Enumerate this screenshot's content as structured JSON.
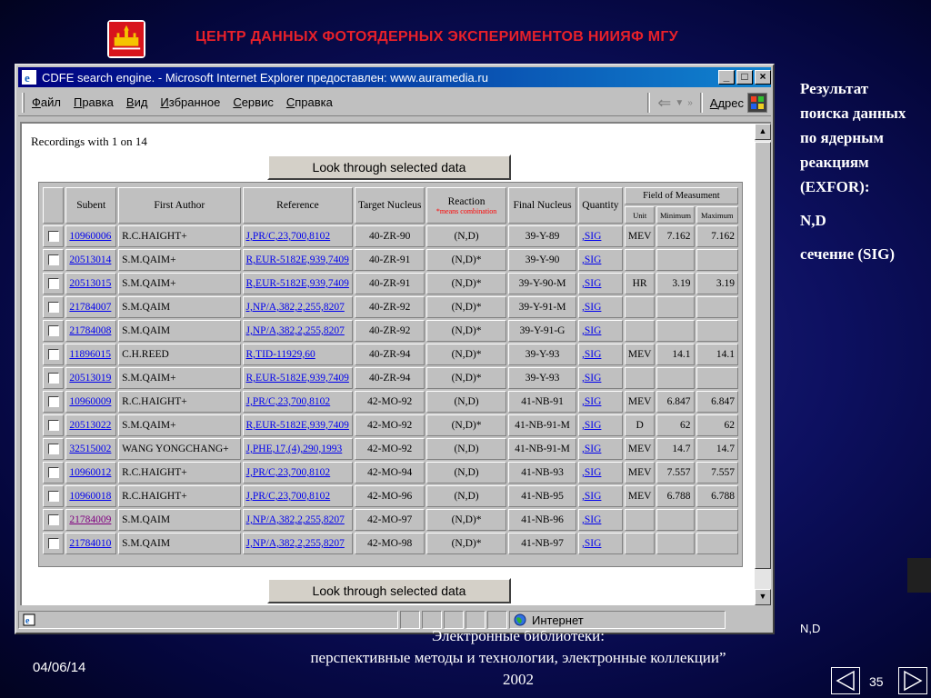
{
  "slide": {
    "title": "ЦЕНТР ДАННЫХ ФОТОЯДЕРНЫХ ЭКСПЕРИМЕНТОВ НИИЯФ МГУ",
    "right_panel": {
      "line1": "Результат поиска данных по ядерным реакциям (EXFOR):",
      "line2": "N,D",
      "line3": "сечение (SIG)"
    },
    "small_label": "N,D",
    "footer": {
      "date": "04/06/14",
      "line1": "Электронные библиотеки:",
      "line2": "перспективные методы и технологии, электронные коллекции”",
      "line3": "2002",
      "page_number": "35"
    }
  },
  "browser": {
    "window_title": "CDFE search engine. - Microsoft Internet Explorer предоставлен: www.auramedia.ru",
    "menu": [
      "Файл",
      "Правка",
      "Вид",
      "Избранное",
      "Сервис",
      "Справка"
    ],
    "address_label": "Адрес",
    "status_zone": "Интернет"
  },
  "page": {
    "recordings": "Recordings with 1 on 14",
    "look_button": "Look through selected data",
    "headers": {
      "subent": "Subent",
      "first_author": "First Author",
      "reference": "Reference",
      "target": "Target Nucleus",
      "reaction": "Reaction",
      "reaction_note": "*means combination",
      "final": "Final Nucleus",
      "quantity": "Quantity",
      "field": "Field of Measument",
      "unit": "Unit",
      "minimum": "Minimum",
      "maximum": "Maximum"
    },
    "rows": [
      {
        "subent": "10960006",
        "author": "R.C.HAIGHT+",
        "ref": "J,PR/C,23,700,8102",
        "target": "40-ZR-90",
        "reaction": "(N,D)",
        "final": "39-Y-89",
        "qty": ",SIG",
        "unit": "MEV",
        "min": "7.162",
        "max": "7.162"
      },
      {
        "subent": "20513014",
        "author": "S.M.QAIM+",
        "ref": "R,EUR-5182E,939,7409",
        "target": "40-ZR-91",
        "reaction": "(N,D)*",
        "final": "39-Y-90",
        "qty": ",SIG",
        "unit": "",
        "min": "",
        "max": ""
      },
      {
        "subent": "20513015",
        "author": "S.M.QAIM+",
        "ref": "R,EUR-5182E,939,7409",
        "target": "40-ZR-91",
        "reaction": "(N,D)*",
        "final": "39-Y-90-M",
        "qty": ",SIG",
        "unit": "HR",
        "min": "3.19",
        "max": "3.19"
      },
      {
        "subent": "21784007",
        "author": "S.M.QAIM",
        "ref": "J,NP/A,382,2,255,8207",
        "target": "40-ZR-92",
        "reaction": "(N,D)*",
        "final": "39-Y-91-M",
        "qty": ",SIG",
        "unit": "",
        "min": "",
        "max": ""
      },
      {
        "subent": "21784008",
        "author": "S.M.QAIM",
        "ref": "J,NP/A,382,2,255,8207",
        "target": "40-ZR-92",
        "reaction": "(N,D)*",
        "final": "39-Y-91-G",
        "qty": ",SIG",
        "unit": "",
        "min": "",
        "max": ""
      },
      {
        "subent": "11896015",
        "author": "C.H.REED",
        "ref": "R,TID-11929,60",
        "target": "40-ZR-94",
        "reaction": "(N,D)*",
        "final": "39-Y-93",
        "qty": ",SIG",
        "unit": "MEV",
        "min": "14.1",
        "max": "14.1"
      },
      {
        "subent": "20513019",
        "author": "S.M.QAIM+",
        "ref": "R,EUR-5182E,939,7409",
        "target": "40-ZR-94",
        "reaction": "(N,D)*",
        "final": "39-Y-93",
        "qty": ",SIG",
        "unit": "",
        "min": "",
        "max": ""
      },
      {
        "subent": "10960009",
        "author": "R.C.HAIGHT+",
        "ref": "J,PR/C,23,700,8102",
        "target": "42-MO-92",
        "reaction": "(N,D)",
        "final": "41-NB-91",
        "qty": ",SIG",
        "unit": "MEV",
        "min": "6.847",
        "max": "6.847"
      },
      {
        "subent": "20513022",
        "author": "S.M.QAIM+",
        "ref": "R,EUR-5182E,939,7409",
        "target": "42-MO-92",
        "reaction": "(N,D)*",
        "final": "41-NB-91-M",
        "qty": ",SIG",
        "unit": "D",
        "min": "62",
        "max": "62"
      },
      {
        "subent": "32515002",
        "author": "WANG YONGCHANG+",
        "ref": "J,PHE,17,(4),290,1993",
        "target": "42-MO-92",
        "reaction": "(N,D)",
        "final": "41-NB-91-M",
        "qty": ",SIG",
        "unit": "MEV",
        "min": "14.7",
        "max": "14.7"
      },
      {
        "subent": "10960012",
        "author": "R.C.HAIGHT+",
        "ref": "J,PR/C,23,700,8102",
        "target": "42-MO-94",
        "reaction": "(N,D)",
        "final": "41-NB-93",
        "qty": ",SIG",
        "unit": "MEV",
        "min": "7.557",
        "max": "7.557"
      },
      {
        "subent": "10960018",
        "author": "R.C.HAIGHT+",
        "ref": "J,PR/C,23,700,8102",
        "target": "42-MO-96",
        "reaction": "(N,D)",
        "final": "41-NB-95",
        "qty": ",SIG",
        "unit": "MEV",
        "min": "6.788",
        "max": "6.788"
      },
      {
        "subent": "21784009",
        "author": "S.M.QAIM",
        "ref": "J,NP/A,382,2,255,8207",
        "target": "42-MO-97",
        "reaction": "(N,D)*",
        "final": "41-NB-96",
        "qty": ",SIG",
        "unit": "",
        "min": "",
        "max": "",
        "visited": true
      },
      {
        "subent": "21784010",
        "author": "S.M.QAIM",
        "ref": "J,NP/A,382,2,255,8207",
        "target": "42-MO-98",
        "reaction": "(N,D)*",
        "final": "41-NB-97",
        "qty": ",SIG",
        "unit": "",
        "min": "",
        "max": ""
      }
    ]
  },
  "colors": {
    "title_red": "#e8202a",
    "link": "#0000ee",
    "visited_link": "#800080",
    "titlebar": "#000080"
  }
}
